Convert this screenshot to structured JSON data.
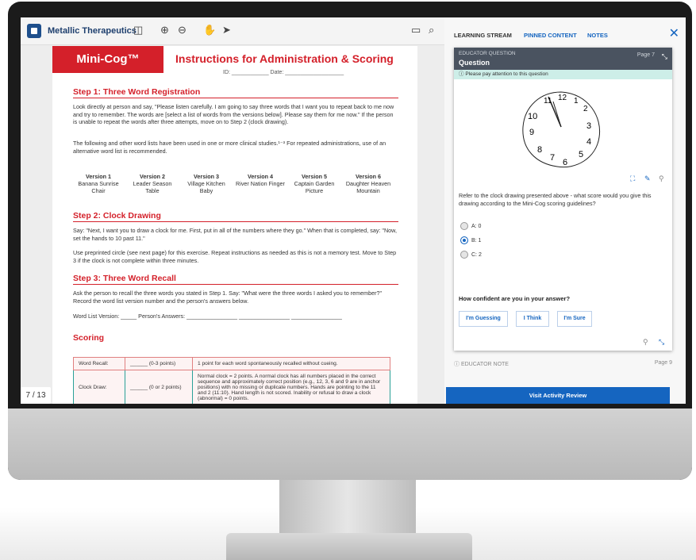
{
  "toolbar": {
    "brand": "Metallic Therapeutics"
  },
  "doc": {
    "brand_box": "Mini-Cog™",
    "title": "Instructions for Administration & Scoring",
    "id_line": "ID: ____________   Date: ___________________",
    "step1_title": "Step 1: Three Word Registration",
    "step1_p1": "Look directly at person and say, \"Please listen carefully. I am going to say three words that I want you to repeat back to me now and try to remember. The words are [select a list of words from the versions below]. Please say them for me now.\" If the person is unable to repeat the words after three attempts, move on to Step 2 (clock drawing).",
    "step1_p2": "The following and other word lists have been used in one or more clinical studies.¹⁻³ For repeated administrations, use of an alternative word list is recommended.",
    "versions": [
      {
        "name": "Version 1",
        "words": "Banana Sunrise Chair"
      },
      {
        "name": "Version 2",
        "words": "Leader Season Table"
      },
      {
        "name": "Version 3",
        "words": "Village Kitchen Baby"
      },
      {
        "name": "Version 4",
        "words": "River Nation Finger"
      },
      {
        "name": "Version 5",
        "words": "Captain Garden Picture"
      },
      {
        "name": "Version 6",
        "words": "Daughter Heaven Mountain"
      }
    ],
    "step2_title": "Step 2: Clock Drawing",
    "step2_p1": "Say: \"Next, I want you to draw a clock for me. First, put in all of the numbers where they go.\" When that is completed, say: \"Now, set the hands to 10 past 11.\"",
    "step2_p2": "Use preprinted circle (see next page) for this exercise. Repeat instructions as needed as this is not a memory test. Move to Step 3 if the clock is not complete within three minutes.",
    "step3_title": "Step 3: Three Word Recall",
    "step3_p1": "Ask the person to recall the three words you stated in Step 1. Say: \"What were the three words I asked you to remember?\" Record the word list version number and the person's answers below.",
    "step3_p2": "Word List Version: _____   Person's Answers: ________________   ________________   ________________",
    "scoring_title": "Scoring",
    "row1_label": "Word Recall:",
    "row1_pts": "______ (0-3 points)",
    "row1_desc": "1 point for each word spontaneously recalled without cueing.",
    "row2_label": "Clock Draw:",
    "row2_pts": "______ (0 or 2 points)",
    "row2_desc": "Normal clock = 2 points. A normal clock has all numbers placed in the correct sequence and approximately correct position (e.g., 12, 3, 6 and 9 are in anchor positions) with no missing or duplicate numbers. Hands are pointing to the 11 and 2 (11:10). Hand length is not scored. Inability or refusal to draw a clock (abnormal) = 0 points.",
    "page_indicator": "7 / 13"
  },
  "panel": {
    "tabs": [
      "LEARNING STREAM",
      "PINNED CONTENT",
      "NOTES"
    ],
    "card_label": "EDUCATOR QUESTION",
    "card_title": "Question",
    "card_page": "Page 7",
    "notice": "Please pay attention to this question",
    "question": "Refer to the clock drawing presented above - what score would you give this drawing according to the Mini-Cog scoring guidelines?",
    "options": [
      "A: 0",
      "B: 1",
      "C: 2"
    ],
    "selected_index": 1,
    "confidence_prompt": "How confident are you in your answer?",
    "conf_buttons": [
      "I'm Guessing",
      "I Think",
      "I'm Sure"
    ],
    "note_label": "EDUCATOR NOTE",
    "note_page": "Page 9",
    "visit_label": "Visit Activity Review",
    "clock_numbers": [
      "11",
      "12",
      "1",
      "2",
      "10",
      "3",
      "9",
      "4",
      "8",
      "5",
      "7",
      "6"
    ]
  },
  "colors": {
    "brand_red": "#d4202a",
    "accent_blue": "#1565c0",
    "teal": "#2aa198",
    "card_header": "#4a5360"
  }
}
